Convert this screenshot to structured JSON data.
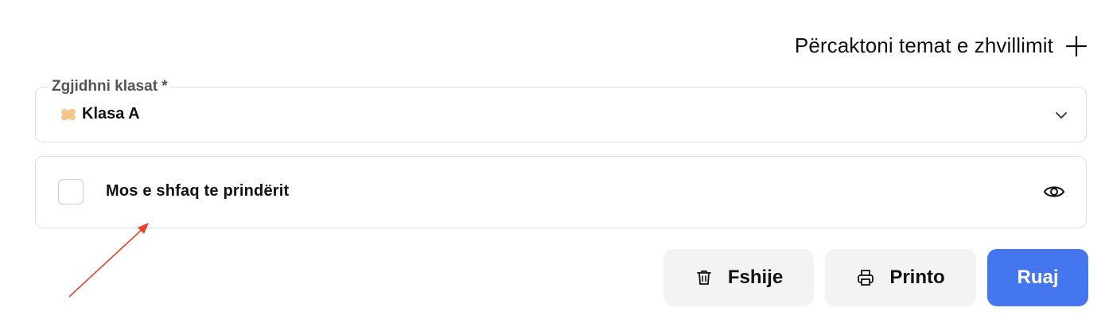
{
  "header": {
    "define_topics_label": "Përcaktoni temat e zhvillimit",
    "define_topics_icon": "plus-icon"
  },
  "class_select": {
    "label": "Zgjidhni klasat *",
    "selected_emoji_icon": "bandage-icon",
    "selected_value": "Klasa A",
    "dropdown_icon": "chevron-down-icon"
  },
  "hide_from_parents": {
    "checked": false,
    "label": "Mos e shfaq te prindërit",
    "visibility_icon": "eye-icon"
  },
  "actions": {
    "delete_label": "Fshije",
    "delete_icon": "trash-icon",
    "print_label": "Printo",
    "print_icon": "printer-icon",
    "save_label": "Ruaj"
  },
  "colors": {
    "primary": "#4476ef",
    "secondary_button_bg": "#f3f3f4",
    "border": "#e1e1e4",
    "annotation_arrow": "#e8432e"
  }
}
